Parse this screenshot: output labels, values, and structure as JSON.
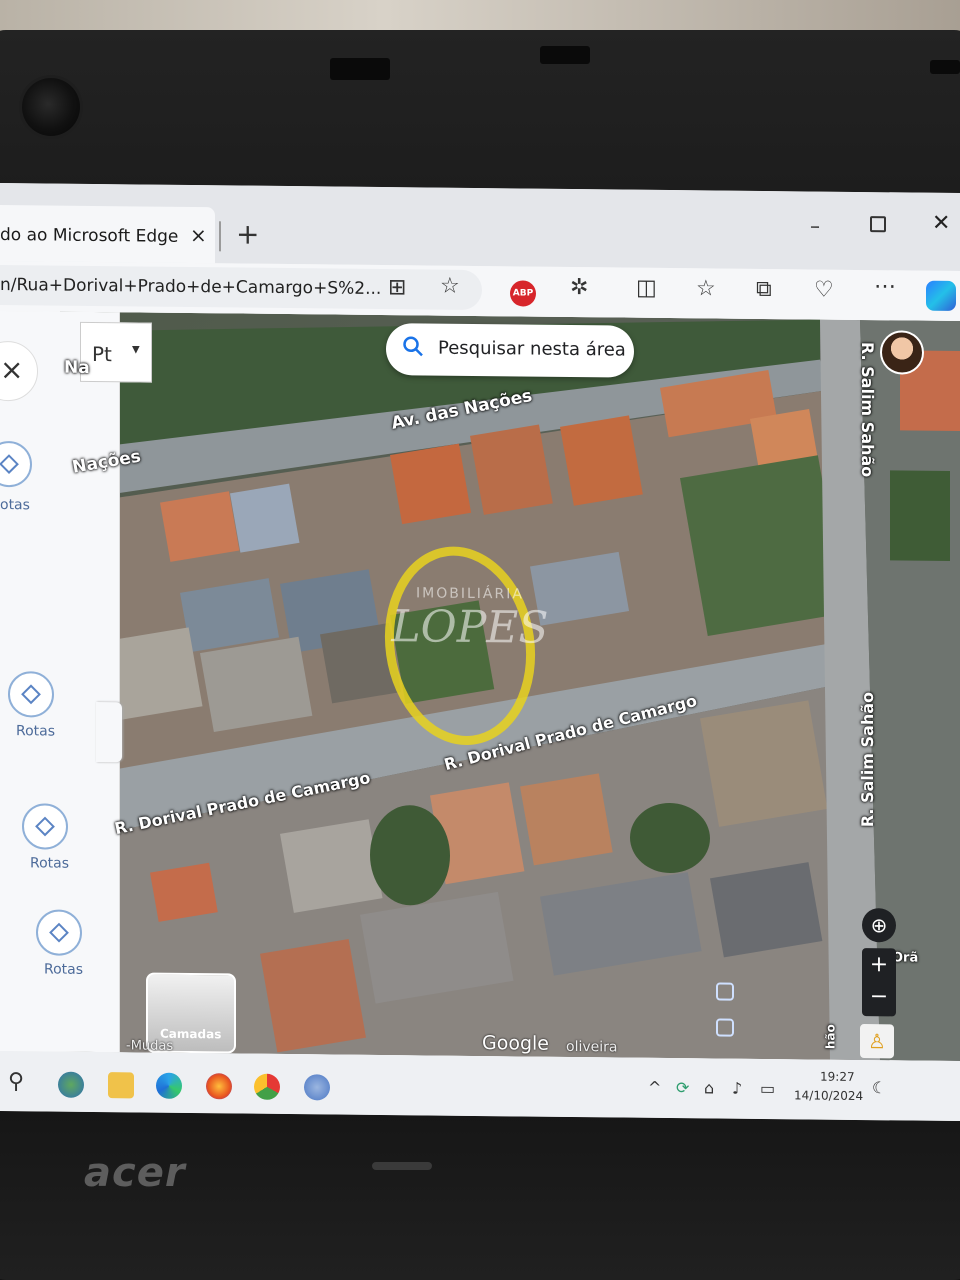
{
  "browser": {
    "tab_title": "do ao Microsoft Edge",
    "tab_close": "×",
    "new_tab": "+",
    "url": "n/Rua+Dorival+Prado+de+Camargo+S%2...",
    "abp_label": "ABP",
    "window": {
      "minimize": "–",
      "close": "✕"
    }
  },
  "map": {
    "search_pill": "Pesquisar nesta área",
    "language_button": "Pt",
    "left_panel": {
      "close": "×",
      "route_labels": [
        "otas",
        "Rotas",
        "Rotas",
        "Rotas"
      ]
    },
    "streets": {
      "nacoes_top": "Av. das Nações",
      "nacoes_left_top": "Na",
      "nacoes_left": "Nações",
      "dorival_center": "R. Dorival Prado de Camargo",
      "dorival_left": "R. Dorival Prado de Camargo",
      "salim_top": "R. Salim Sahão",
      "salim_bottom": "R. Salim Sahão"
    },
    "watermark": {
      "line1": "IMOBILIÁRIA",
      "line2": "LOPES"
    },
    "controls": {
      "zoom_in": "+",
      "zoom_out": "−"
    },
    "layers_label": "Camadas",
    "attribution": "Google",
    "attribution_suffix": "oliveira",
    "bottom_left_text": "-Mudas",
    "edge_text_right": "Orã",
    "edge_text_right2": "hão"
  },
  "taskbar": {
    "time": "19:27",
    "date": "14/10/2024"
  },
  "laptop": {
    "brand": "acer"
  },
  "colors": {
    "edge_accent": "#2b7fff",
    "highlight_ring": "#e8d21e",
    "abp_red": "#d7252b"
  }
}
